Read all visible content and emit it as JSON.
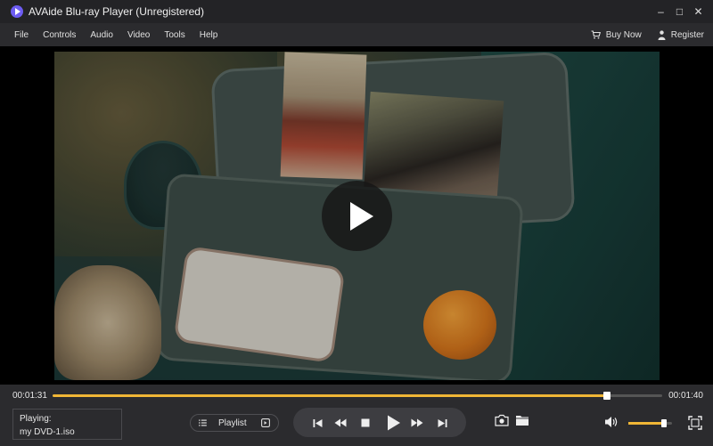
{
  "window": {
    "title": "AVAide Blu-ray Player (Unregistered)",
    "minimize_glyph": "–",
    "maximize_glyph": "□",
    "close_glyph": "✕"
  },
  "menu": {
    "items": [
      "File",
      "Controls",
      "Audio",
      "Video",
      "Tools",
      "Help"
    ],
    "buy_now": "Buy Now",
    "register": "Register"
  },
  "player": {
    "time_current": "00:01:31",
    "time_total": "00:01:40",
    "progress_fraction": 0.91,
    "volume_fraction": 0.82,
    "playing_label": "Playing:",
    "playing_file": "my DVD-1.iso",
    "playlist_label": "Playlist"
  },
  "colors": {
    "accent": "#f0b636",
    "logo": "#6d5cf2",
    "background": "#2b2b2e"
  },
  "icons": [
    "app-logo-icon",
    "cart-icon",
    "user-icon",
    "list-icon",
    "add-to-playlist-icon",
    "previous-icon",
    "rewind-icon",
    "stop-icon",
    "play-icon",
    "fast-forward-icon",
    "next-icon",
    "snapshot-icon",
    "folder-icon",
    "volume-icon",
    "fullscreen-icon"
  ]
}
